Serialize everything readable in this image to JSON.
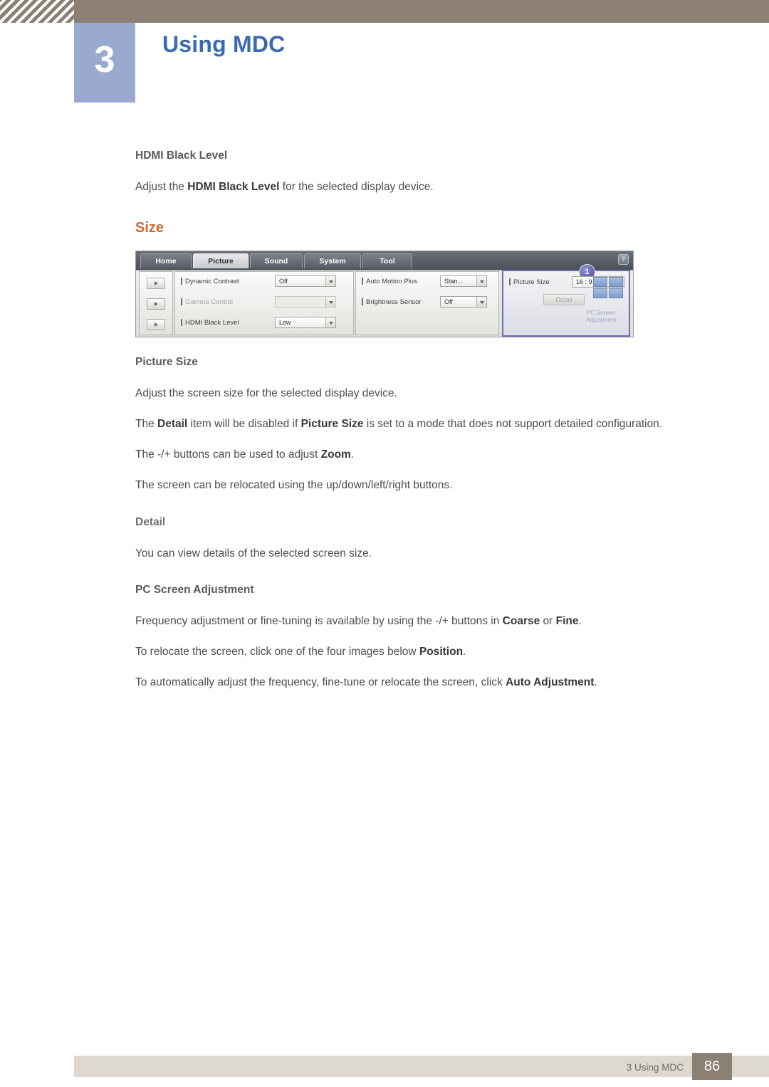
{
  "header": {
    "chapter_number": "3",
    "chapter_title": "Using MDC"
  },
  "content": {
    "hdmi_black_level_head": "HDMI Black Level",
    "hdmi_black_level_text_1": "Adjust the ",
    "hdmi_black_level_text_bold": "HDMI Black Level",
    "hdmi_black_level_text_2": " for the selected display device.",
    "size_section_title": "Size",
    "picture_size_head": "Picture Size",
    "picture_size_text": "Adjust the screen size for the selected display device.",
    "detail_disable_text_1": "The ",
    "detail_disable_bold_1": "Detail",
    "detail_disable_text_2": " item will be disabled if ",
    "detail_disable_bold_2": "Picture Size",
    "detail_disable_text_3": " is set to a mode that does not support detailed configuration.",
    "zoom_text_1": "The -/+ buttons can be used to adjust ",
    "zoom_bold": "Zoom",
    "zoom_text_2": ".",
    "relocate_text": "The screen can be relocated using the up/down/left/right buttons.",
    "detail_head": "Detail",
    "detail_text": "You can view details of the selected screen size.",
    "pc_screen_head": "PC Screen Adjustment",
    "frequency_text_1": "Frequency adjustment or fine-tuning is available by using the -/+ buttons in ",
    "frequency_bold_1": "Coarse",
    "frequency_text_2": " or ",
    "frequency_bold_2": "Fine",
    "frequency_text_3": ".",
    "position_text_1": "To relocate the screen, click one of the four images below ",
    "position_bold": "Position",
    "position_text_2": ".",
    "auto_text_1": "To automatically adjust the frequency, fine-tune or relocate the screen, click ",
    "auto_bold": "Auto Adjustment",
    "auto_text_2": "."
  },
  "mdc": {
    "tabs": [
      {
        "label": "Home",
        "active": false
      },
      {
        "label": "Picture",
        "active": true
      },
      {
        "label": "Sound",
        "active": false
      },
      {
        "label": "System",
        "active": false
      },
      {
        "label": "Tool",
        "active": false
      }
    ],
    "help_label": "?",
    "col1": [
      {
        "label": "Dynamic Contrast",
        "value": "Off",
        "dim": false
      },
      {
        "label": "Gamma Control",
        "value": "",
        "dim": true
      },
      {
        "label": "HDMI Black Level",
        "value": "Low",
        "dim": false
      }
    ],
    "col2": [
      {
        "label": "Auto Motion Plus",
        "value": "Stan...",
        "dim": false
      },
      {
        "label": "Brightness Sensor",
        "value": "Off",
        "dim": false
      }
    ],
    "col3": {
      "label": "Picture Size",
      "value": "16 : 9",
      "detail_button": "Detail",
      "pc_screen_line1": "PC Screen",
      "pc_screen_line2": "Adjustment",
      "callout": "1"
    }
  },
  "footer": {
    "label": "3 Using MDC",
    "page": "86"
  },
  "colors": {
    "accent_orange": "#cc6a33",
    "title_blue": "#3a6bb0",
    "badge_blue": "#9aa9cf",
    "header_brown": "#8b8073",
    "footer_band": "#ded9d0"
  }
}
